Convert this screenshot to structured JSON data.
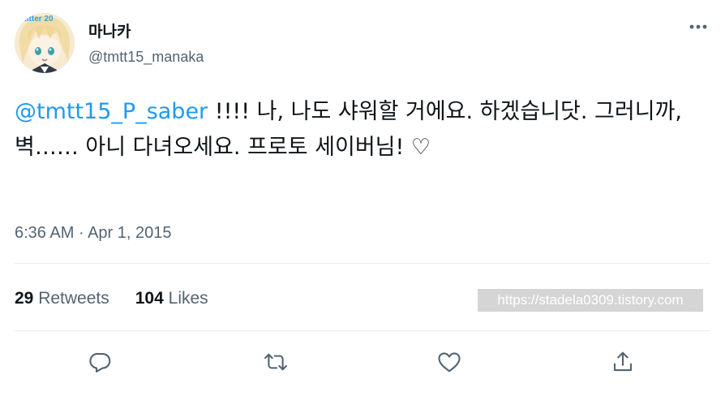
{
  "author": {
    "display_name": "마나카",
    "handle": "@tmtt15_manaka",
    "avatar_label": "iitter 20"
  },
  "tweet": {
    "mention": "@tmtt15_P_saber",
    "text": " !!!! 나, 나도 샤워할 거에요. 하겠습니닷. 그러니까, 벽…… 아니 다녀오세요. 프로토 세이버님! ♡",
    "time": "6:36 AM",
    "separator": " · ",
    "date": "Apr 1, 2015"
  },
  "stats": {
    "retweets_count": "29",
    "retweets_label": "Retweets",
    "likes_count": "104",
    "likes_label": "Likes"
  },
  "watermark": "https://stadela0309.tistory.com",
  "icons": {
    "more": "more-icon",
    "reply": "reply-icon",
    "retweet": "retweet-icon",
    "like": "heart-icon",
    "share": "share-icon"
  },
  "colors": {
    "mention": "#1d9bf0",
    "secondary_text": "#536471",
    "divider": "#e6ecf0"
  }
}
